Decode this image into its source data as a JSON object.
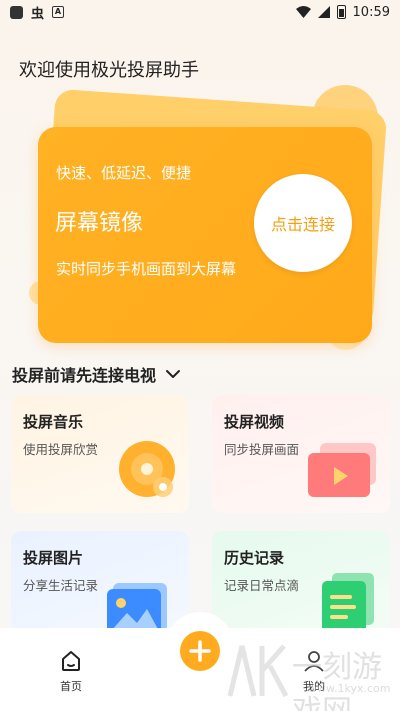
{
  "status_bar": {
    "glyph": "虫",
    "a_badge": "A",
    "time": "10:59"
  },
  "welcome": "欢迎使用极光投屏助手",
  "hero": {
    "subtitle": "快速、低延迟、便捷",
    "title": "屏幕镜像",
    "description": "实时同步手机画面到大屏幕",
    "connect_label": "点击连接"
  },
  "section": {
    "title": "投屏前请先连接电视"
  },
  "cards": [
    {
      "title": "投屏音乐",
      "desc": "使用投屏欣赏"
    },
    {
      "title": "投屏视频",
      "desc": "同步投屏画面"
    },
    {
      "title": "投屏图片",
      "desc": "分享生活记录"
    },
    {
      "title": "历史记录",
      "desc": "记录日常点滴"
    }
  ],
  "nav": {
    "home": "首页",
    "mine": "我的"
  },
  "watermark": {
    "text": "一刻游戏网",
    "url": "www.1kyx.com"
  },
  "colors": {
    "accent": "#ffab1f",
    "connect_text": "#f5a013"
  }
}
